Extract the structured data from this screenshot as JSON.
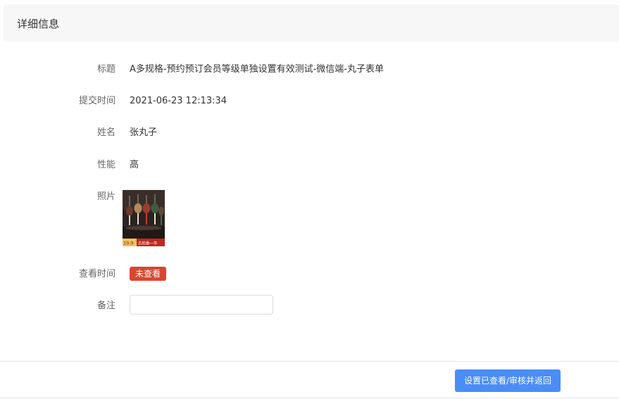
{
  "header": {
    "title": "详细信息"
  },
  "fields": {
    "title_label": "标题",
    "title_value": "A多规格-预约预订会员等级单独设置有效测试-微信端-丸子表单",
    "submit_time_label": "提交时间",
    "submit_time_value": "2021-06-23 12:13:34",
    "name_label": "姓名",
    "name_value": "张丸子",
    "performance_label": "性能",
    "performance_value": "高",
    "photo_label": "照片",
    "photo_price_text": "19.9",
    "photo_caption_text": "古柏香一年",
    "view_time_label": "查看时间",
    "view_status_badge": "未查看",
    "remark_label": "备注",
    "remark_value": ""
  },
  "footer": {
    "submit_label": "设置已查看/审核并返回"
  },
  "colors": {
    "header_bg": "#f7f7f7",
    "badge_red": "#d9472f",
    "primary_blue": "#4a8df7"
  }
}
